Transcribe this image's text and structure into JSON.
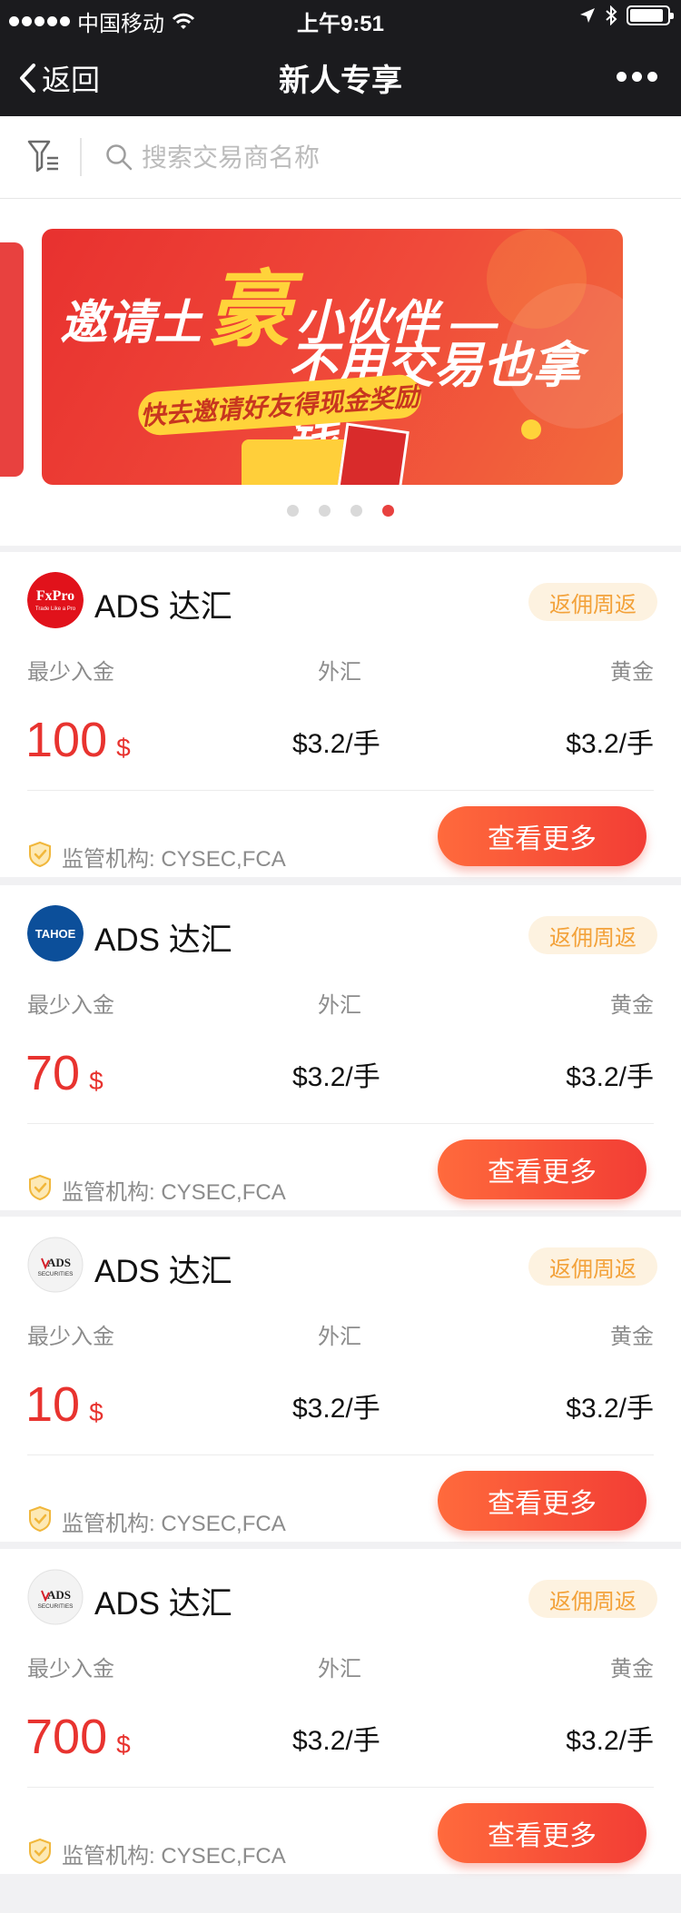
{
  "status_bar": {
    "carrier": "中国移动",
    "time": "上午9:51",
    "battery_level": 0.9
  },
  "nav": {
    "back_label": "返回",
    "title": "新人专享"
  },
  "search": {
    "placeholder": "搜索交易商名称"
  },
  "banner": {
    "line1_a": "邀请土",
    "line1_big": "豪",
    "line1_b": "小伙伴 —",
    "line2": "不用交易也拿钱",
    "pill": "快去邀请好友得现金奖励",
    "page_count": 4,
    "active_page": 4
  },
  "labels": {
    "min_deposit": "最少入金",
    "forex": "外汇",
    "gold": "黄金",
    "regulator_prefix": "监管机构:",
    "more_button": "查看更多",
    "currency": "$"
  },
  "brokers": [
    {
      "logo": "fxpro-logo",
      "logo_text": "FxPro",
      "logo_sub": "Trade Like a Pro",
      "name": "ADS 达汇",
      "tag": "返佣周返",
      "min_deposit": "100",
      "forex_rate": "$3.2/手",
      "gold_rate": "$3.2/手",
      "regulator": "CYSEC,FCA"
    },
    {
      "logo": "tahoe-logo",
      "logo_text": "TAHOE",
      "name": "ADS 达汇",
      "tag": "返佣周返",
      "min_deposit": "70",
      "forex_rate": "$3.2/手",
      "gold_rate": "$3.2/手",
      "regulator": "CYSEC,FCA"
    },
    {
      "logo": "ads-securities-logo",
      "logo_text": "ADS",
      "logo_sub": "SECURITIES",
      "name": "ADS 达汇",
      "tag": "返佣周返",
      "min_deposit": "10",
      "forex_rate": "$3.2/手",
      "gold_rate": "$3.2/手",
      "regulator": "CYSEC,FCA"
    },
    {
      "logo": "ads-securities-logo",
      "logo_text": "ADS",
      "logo_sub": "SECURITIES",
      "name": "ADS 达汇",
      "tag": "返佣周返",
      "min_deposit": "700",
      "forex_rate": "$3.2/手",
      "gold_rate": "$3.2/手",
      "regulator": "CYSEC,FCA"
    }
  ],
  "colors": {
    "accent_red": "#e8332f",
    "tag_bg": "#fdf2e0",
    "tag_text": "#f3a23a",
    "nav_bg": "#1b1b1e"
  }
}
